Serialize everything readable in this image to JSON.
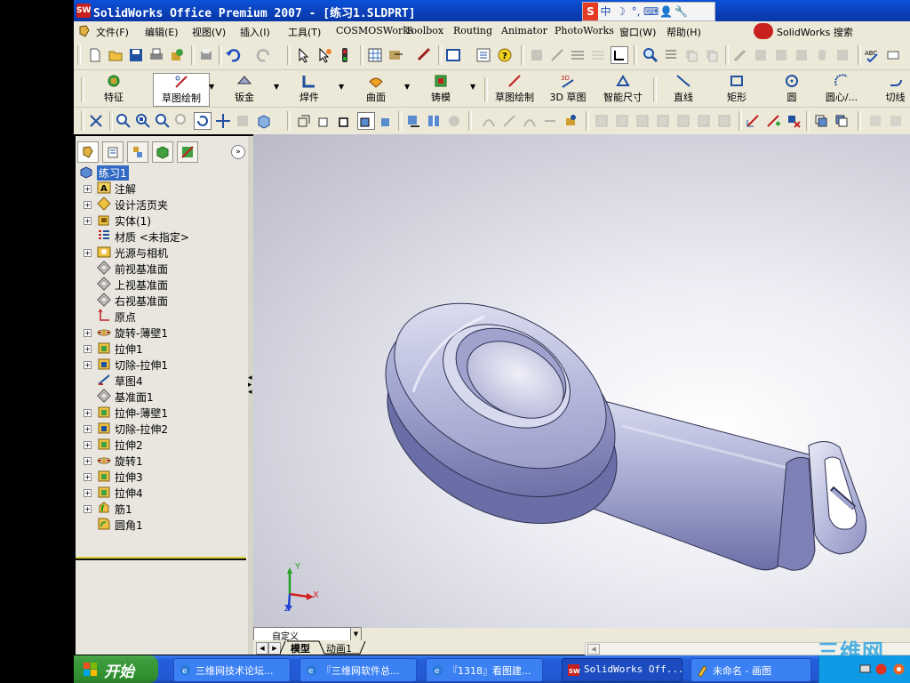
{
  "window": {
    "title": "SolidWorks Office Premium 2007 - [练习1.SLDPRT]"
  },
  "ime": {
    "items": [
      "S",
      "中",
      "☽",
      "°,",
      "⌨",
      "👤",
      "🔧"
    ]
  },
  "menu": {
    "items": [
      "文件(F)",
      "编辑(E)",
      "视图(V)",
      "插入(I)",
      "工具(T)",
      "COSMOSWorks",
      "Toolbox",
      "Routing",
      "Animator",
      "PhotoWorks",
      "窗口(W)",
      "帮助(H)"
    ],
    "search_label": "SolidWorks 搜索"
  },
  "command_manager": {
    "buttons": [
      "特征",
      "草图绘制",
      "钣金",
      "焊件",
      "曲面",
      "铸模",
      "草图绘制",
      "3D 草图",
      "智能尺寸",
      "直线",
      "矩形",
      "圆",
      "圆心/...",
      "切线"
    ]
  },
  "feature_tree": {
    "root": "练习1",
    "items": [
      {
        "label": "注解",
        "icon": "annotation-icon",
        "expand": true
      },
      {
        "label": "设计活页夹",
        "icon": "design-binder-icon",
        "expand": true
      },
      {
        "label": "实体(1)",
        "icon": "solid-bodies-icon",
        "expand": true
      },
      {
        "label": "材质 <未指定>",
        "icon": "material-icon",
        "expand": false
      },
      {
        "label": "光源与相机",
        "icon": "lights-cameras-icon",
        "expand": true
      },
      {
        "label": "前视基准面",
        "icon": "plane-icon",
        "expand": false
      },
      {
        "label": "上视基准面",
        "icon": "plane-icon",
        "expand": false
      },
      {
        "label": "右视基准面",
        "icon": "plane-icon",
        "expand": false
      },
      {
        "label": "原点",
        "icon": "origin-icon",
        "expand": false
      },
      {
        "label": "旋转-薄壁1",
        "icon": "revolve-icon",
        "expand": true
      },
      {
        "label": "拉伸1",
        "icon": "extrude-icon",
        "expand": true
      },
      {
        "label": "切除-拉伸1",
        "icon": "cut-extrude-icon",
        "expand": true
      },
      {
        "label": "草图4",
        "icon": "sketch-icon",
        "expand": false
      },
      {
        "label": "基准面1",
        "icon": "plane-icon",
        "expand": false
      },
      {
        "label": "拉伸-薄壁1",
        "icon": "extrude-icon",
        "expand": true
      },
      {
        "label": "切除-拉伸2",
        "icon": "cut-extrude-icon",
        "expand": true
      },
      {
        "label": "拉伸2",
        "icon": "extrude-icon",
        "expand": true
      },
      {
        "label": "旋转1",
        "icon": "revolve-icon",
        "expand": true
      },
      {
        "label": "拉伸3",
        "icon": "extrude-icon",
        "expand": true
      },
      {
        "label": "拉伸4",
        "icon": "extrude-icon",
        "expand": true
      },
      {
        "label": "筋1",
        "icon": "rib-icon",
        "expand": true
      },
      {
        "label": "圆角1",
        "icon": "fillet-icon",
        "expand": false
      }
    ]
  },
  "viewport": {
    "triad": {
      "x": "X",
      "y": "Y",
      "z": "Z"
    },
    "configuration": "自定义"
  },
  "bottom_tabs": [
    "模型",
    "动画1"
  ],
  "taskbar": {
    "start": "开始",
    "tasks": [
      "三维网技术论坛...",
      "『三维网软件总...",
      "『1318』看图建...",
      "SolidWorks Off...",
      "未命名 - 画图"
    ]
  },
  "watermark": "三维网",
  "colors": {
    "titlebar": "#0a4fd4",
    "selection": "#316ac5",
    "taskbar": "#245edb",
    "start": "#3c9b3c"
  }
}
